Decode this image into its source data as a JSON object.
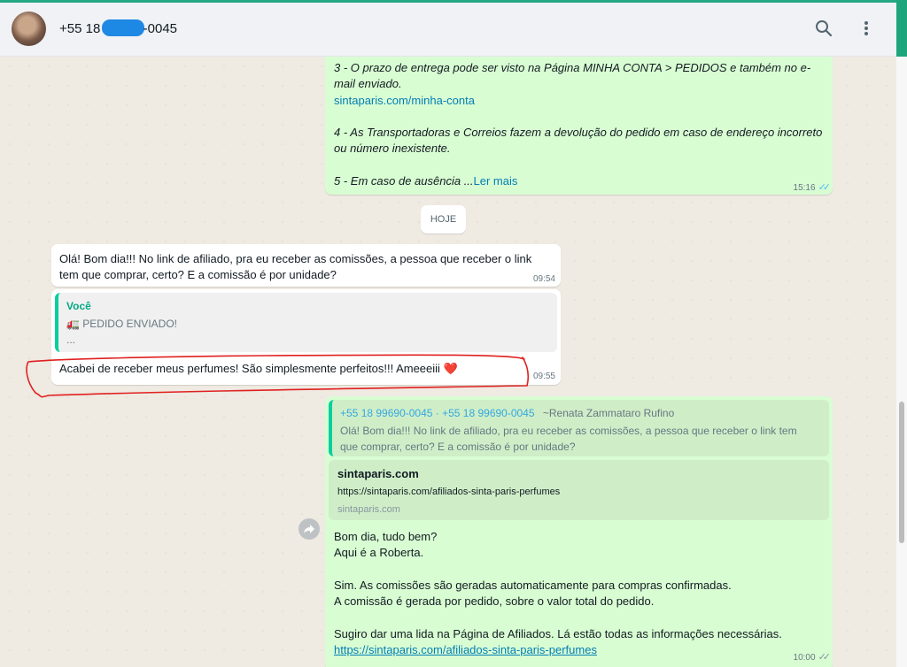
{
  "header": {
    "contact_prefix": "+55 18",
    "contact_suffix": "-0045"
  },
  "msg1": {
    "line1": "3 - O prazo de entrega pode ser visto na Página MINHA CONTA > PEDIDOS e também no e-",
    "line2": "mail enviado.",
    "link": "sintaparis.com/minha-conta",
    "line3": "4 - As Transportadoras e Correios fazem a devolução do pedido em caso de endereço incorreto",
    "line4": "ou número inexistente.",
    "line5": "5 - Em caso de ausência ...",
    "read_more": "Ler mais",
    "time": "15:16"
  },
  "date_divider": "HOJE",
  "msg2": {
    "line1": "Olá! Bom dia!!! No link de afiliado, pra eu receber as comissões, a pessoa que receber o link",
    "line2": "tem que comprar, certo? E a comissão é por unidade?",
    "time": "09:54"
  },
  "msg3": {
    "quote_author": "Você",
    "quote_icon": "🚛",
    "quote_text": "PEDIDO ENVIADO!",
    "quote_more": "...",
    "text": "Acabei de receber meus perfumes! São simplesmente perfeitos!!! Ameeeiii ❤️",
    "time": "09:55"
  },
  "msg4": {
    "quote_author": "+55 18 99690-0045 · +55 18 99690-0045",
    "quote_name": "~Renata Zammataro Rufino",
    "quote_line1": "Olá! Bom dia!!! No link de afiliado, pra eu receber as comissões, a pessoa que receber o link tem",
    "quote_line2": "que comprar, certo? E a comissão é por unidade?",
    "preview_title": "sintaparis.com",
    "preview_url": "https://sintaparis.com/afiliados-sinta-paris-perfumes",
    "preview_domain": "sintaparis.com",
    "line1": "Bom dia, tudo bem?",
    "line2": "Aqui é a Roberta.",
    "line3": "Sim. As comissões são geradas automaticamente para compras confirmadas.",
    "line4": "A comissão é gerada por pedido, sobre o valor total do pedido.",
    "line5": "Sugiro dar uma lida na Página de Afiliados. Lá estão todas as informações necessárias.",
    "link": "https://sintaparis.com/afiliados-sinta-paris-perfumes",
    "time": "10:00"
  },
  "colors": {
    "outgoing_bubble": "#d9fdd3",
    "incoming_bubble": "#ffffff",
    "link": "#027eb5",
    "quote_bar": "#06cf9c",
    "annotation": "#e02020"
  }
}
